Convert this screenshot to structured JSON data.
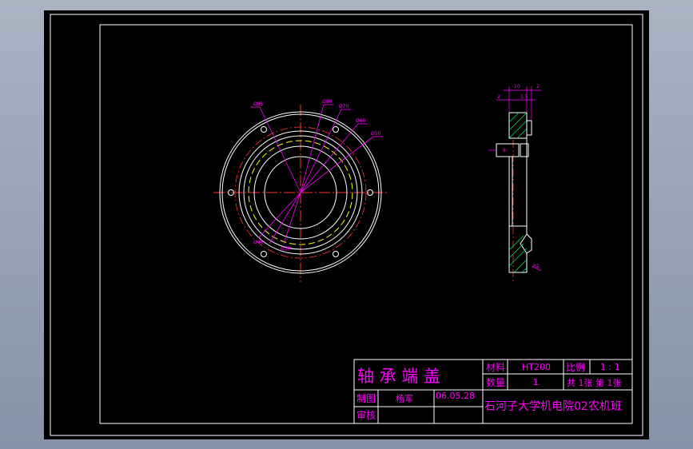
{
  "title_block": {
    "part_name": "轴 承 端 盖",
    "material_label": "材料",
    "material_value": "HT200",
    "scale_label": "比例",
    "scale_value": "1 : 1",
    "quantity_label": "数量",
    "quantity_value": "1",
    "sheets": "共 1张 第 1张",
    "drawn_label": "制图",
    "drawn_by": "杨军",
    "date": "06.05.28",
    "checked_label": "审核",
    "organization": "石河子大学机电院02农机班"
  },
  "colors": {
    "background": "#000000",
    "frame": "#ffffff",
    "dimension": "#ff00ff",
    "centerline": "#ff0000",
    "hidden": "#ffff00",
    "hatch": "#00ff66"
  },
  "front_view_dims": [
    "Ø85",
    "Ø80",
    "Ø70",
    "Ø60",
    "Ø50",
    "Ø46",
    "Ø30"
  ],
  "section_dims": [
    "10",
    "2",
    "2",
    "1.5",
    "8",
    "R2"
  ]
}
